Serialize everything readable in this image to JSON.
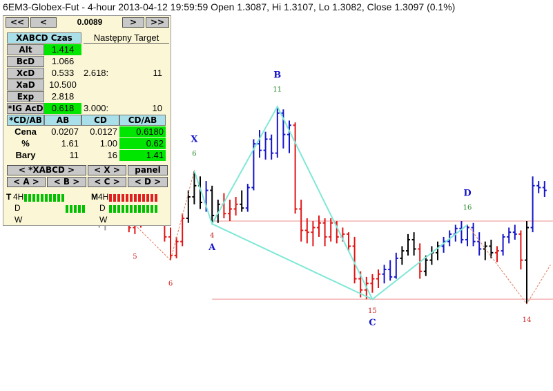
{
  "title": "6EM3-Globex-Fut - 4-hour 2013-04-12 19:59:59 Open 1.3087, Hi 1.3107, Lo 1.3082, Close 1.3097 (0.1%)",
  "colors": {
    "up": "#1515c8",
    "down": "#e01515",
    "neutral": "#000000",
    "gray": "#9a9a9a",
    "pattern_line": "#7fe8d6",
    "zigzag": "#e07a5a",
    "hline": "#f4b4b4",
    "label_blue": "#1515c8",
    "label_green": "#2a8a2a",
    "label_red": "#cc2222",
    "panel_bg": "#fbf7d6",
    "green_cell": "#00e600",
    "header_blue": "#a9dfe8"
  },
  "panel": {
    "nav": {
      "first": "<<",
      "prev": "<",
      "value": "0.0089",
      "next": ">",
      "last": ">>"
    },
    "header_left": "XABCD Czas",
    "header_right": "Następny Target",
    "ratios": [
      {
        "label": "Alt",
        "value": "1.414",
        "target": "",
        "count": ""
      },
      {
        "label": "BcD",
        "value": "1.066",
        "target": "",
        "count": ""
      },
      {
        "label": "XcD",
        "value": "0.533",
        "target": "2.618:",
        "count": "11"
      },
      {
        "label": "XaD",
        "value": "10.500",
        "target": "",
        "count": ""
      },
      {
        "label": "Exp",
        "value": "2.818",
        "target": "",
        "count": ""
      },
      {
        "label": "*IG AcD",
        "value": "0.618",
        "target": "3.000:",
        "count": "10"
      }
    ],
    "table": {
      "cols": [
        "*CD/AB",
        "AB",
        "CD",
        "CD/AB"
      ],
      "rows": [
        {
          "label": "Cena",
          "ab": "0.0207",
          "cd": "0.0127",
          "cdab": "0.6180"
        },
        {
          "label": "%",
          "ab": "1.61",
          "cd": "1.00",
          "cdab": "0.62"
        },
        {
          "label": "Bary",
          "ab": "11",
          "cd": "16",
          "cdab": "1.41"
        }
      ]
    },
    "buttons_row1": {
      "xabcd": "<    *XABCD    >",
      "x": "<  X  >",
      "panel": "panel"
    },
    "buttons_row2": {
      "a": "<  A  >",
      "b": "<  B  >",
      "c": "<  C  >",
      "d": "<  D  >"
    },
    "trend": {
      "t_label": "T",
      "m_label": "M",
      "tf_4h": "4H",
      "tf_d": "D",
      "tf_w": "W"
    }
  },
  "chart_data": {
    "type": "ohlc",
    "instrument": "6EM3-Globex-Fut",
    "timeframe": "4-hour",
    "ylim": [
      1.2785,
      1.3145
    ],
    "pattern_points": [
      {
        "name": "X",
        "bar": 24,
        "price": 1.3006,
        "bar_count": "6"
      },
      {
        "name": "A",
        "bar": 27,
        "price": 1.2949,
        "bar_count": "4"
      },
      {
        "name": "B",
        "bar": 38,
        "price": 1.3075,
        "bar_count": "11"
      },
      {
        "name": "C",
        "bar": 54,
        "price": 1.2868,
        "bar_count": "15"
      },
      {
        "name": "D",
        "bar": 70,
        "price": 1.2948,
        "bar_count": "16"
      }
    ],
    "zigzag_labels": [
      {
        "text": "5",
        "bar": 14,
        "price": 1.2931
      },
      {
        "text": "6",
        "bar": 20,
        "price": 1.2902
      },
      {
        "text": "14",
        "bar": 80,
        "price": 1.2863
      }
    ],
    "hlines": [
      1.2952,
      1.2868
    ],
    "bars": [
      {
        "o": 1.299,
        "h": 1.2995,
        "l": 1.297,
        "c": 1.2985,
        "col": "gray"
      },
      {
        "o": 1.2985,
        "h": 1.2992,
        "l": 1.2968,
        "c": 1.2975,
        "col": "gray"
      },
      {
        "o": 1.2975,
        "h": 1.2985,
        "l": 1.2962,
        "c": 1.298,
        "col": "gray"
      },
      {
        "o": 1.298,
        "h": 1.2988,
        "l": 1.2968,
        "c": 1.2972,
        "col": "gray"
      },
      {
        "o": 1.2972,
        "h": 1.298,
        "l": 1.296,
        "c": 1.2966,
        "col": "gray"
      },
      {
        "o": 1.2966,
        "h": 1.2975,
        "l": 1.2955,
        "c": 1.2962,
        "col": "gray"
      },
      {
        "o": 1.2962,
        "h": 1.297,
        "l": 1.295,
        "c": 1.2958,
        "col": "gray"
      },
      {
        "o": 1.2958,
        "h": 1.2966,
        "l": 1.2948,
        "c": 1.2955,
        "col": "gray"
      },
      {
        "o": 1.2955,
        "h": 1.2965,
        "l": 1.2945,
        "c": 1.295,
        "col": "gray"
      },
      {
        "o": 1.295,
        "h": 1.2962,
        "l": 1.2942,
        "c": 1.2958,
        "col": "gray"
      },
      {
        "o": 1.2958,
        "h": 1.297,
        "l": 1.295,
        "c": 1.2966,
        "col": "gray"
      },
      {
        "o": 1.2966,
        "h": 1.2975,
        "l": 1.2955,
        "c": 1.296,
        "col": "gray"
      },
      {
        "o": 1.296,
        "h": 1.297,
        "l": 1.295,
        "c": 1.2955,
        "col": "down"
      },
      {
        "o": 1.2955,
        "h": 1.2962,
        "l": 1.294,
        "c": 1.2945,
        "col": "down"
      },
      {
        "o": 1.2945,
        "h": 1.2955,
        "l": 1.2938,
        "c": 1.295,
        "col": "down"
      },
      {
        "o": 1.295,
        "h": 1.2966,
        "l": 1.2945,
        "c": 1.296,
        "col": "down"
      },
      {
        "o": 1.296,
        "h": 1.297,
        "l": 1.295,
        "c": 1.2962,
        "col": "down"
      },
      {
        "o": 1.2962,
        "h": 1.2975,
        "l": 1.2955,
        "c": 1.2968,
        "col": "down"
      },
      {
        "o": 1.2968,
        "h": 1.2975,
        "l": 1.295,
        "c": 1.2955,
        "col": "down"
      },
      {
        "o": 1.2955,
        "h": 1.296,
        "l": 1.293,
        "c": 1.2935,
        "col": "down"
      },
      {
        "o": 1.2935,
        "h": 1.2945,
        "l": 1.291,
        "c": 1.2915,
        "col": "down"
      },
      {
        "o": 1.2915,
        "h": 1.2935,
        "l": 1.2912,
        "c": 1.293,
        "col": "down"
      },
      {
        "o": 1.293,
        "h": 1.296,
        "l": 1.2925,
        "c": 1.2955,
        "col": "down"
      },
      {
        "o": 1.2955,
        "h": 1.2985,
        "l": 1.295,
        "c": 1.2978,
        "col": "neutral"
      },
      {
        "o": 1.2978,
        "h": 1.3006,
        "l": 1.297,
        "c": 1.299,
        "col": "neutral"
      },
      {
        "o": 1.299,
        "h": 1.3,
        "l": 1.2965,
        "c": 1.2972,
        "col": "neutral"
      },
      {
        "o": 1.2972,
        "h": 1.2995,
        "l": 1.2962,
        "c": 1.2985,
        "col": "up"
      },
      {
        "o": 1.2985,
        "h": 1.299,
        "l": 1.2949,
        "c": 1.2958,
        "col": "neutral"
      },
      {
        "o": 1.2958,
        "h": 1.2975,
        "l": 1.295,
        "c": 1.297,
        "col": "neutral"
      },
      {
        "o": 1.297,
        "h": 1.2982,
        "l": 1.2955,
        "c": 1.296,
        "col": "down"
      },
      {
        "o": 1.296,
        "h": 1.2975,
        "l": 1.2952,
        "c": 1.2965,
        "col": "down"
      },
      {
        "o": 1.2965,
        "h": 1.2978,
        "l": 1.2958,
        "c": 1.297,
        "col": "down"
      },
      {
        "o": 1.297,
        "h": 1.2985,
        "l": 1.2962,
        "c": 1.2966,
        "col": "neutral"
      },
      {
        "o": 1.2966,
        "h": 1.2992,
        "l": 1.2962,
        "c": 1.2988,
        "col": "up"
      },
      {
        "o": 1.2988,
        "h": 1.304,
        "l": 1.2985,
        "c": 1.3035,
        "col": "up"
      },
      {
        "o": 1.3035,
        "h": 1.305,
        "l": 1.302,
        "c": 1.3028,
        "col": "up"
      },
      {
        "o": 1.3028,
        "h": 1.3048,
        "l": 1.3018,
        "c": 1.304,
        "col": "up"
      },
      {
        "o": 1.304,
        "h": 1.3045,
        "l": 1.3018,
        "c": 1.3025,
        "col": "up"
      },
      {
        "o": 1.3025,
        "h": 1.3075,
        "l": 1.302,
        "c": 1.3068,
        "col": "up"
      },
      {
        "o": 1.3068,
        "h": 1.3072,
        "l": 1.303,
        "c": 1.3045,
        "col": "up"
      },
      {
        "o": 1.3045,
        "h": 1.306,
        "l": 1.3025,
        "c": 1.3055,
        "col": "up"
      },
      {
        "o": 1.3055,
        "h": 1.3058,
        "l": 1.296,
        "c": 1.2965,
        "col": "down"
      },
      {
        "o": 1.2965,
        "h": 1.2975,
        "l": 1.293,
        "c": 1.2942,
        "col": "down"
      },
      {
        "o": 1.2942,
        "h": 1.2955,
        "l": 1.2928,
        "c": 1.294,
        "col": "down"
      },
      {
        "o": 1.294,
        "h": 1.2952,
        "l": 1.2925,
        "c": 1.2945,
        "col": "down"
      },
      {
        "o": 1.2945,
        "h": 1.2958,
        "l": 1.2935,
        "c": 1.295,
        "col": "down"
      },
      {
        "o": 1.295,
        "h": 1.2955,
        "l": 1.2925,
        "c": 1.2935,
        "col": "down"
      },
      {
        "o": 1.2935,
        "h": 1.2955,
        "l": 1.293,
        "c": 1.295,
        "col": "down"
      },
      {
        "o": 1.295,
        "h": 1.2952,
        "l": 1.2928,
        "c": 1.2935,
        "col": "down"
      },
      {
        "o": 1.2935,
        "h": 1.2945,
        "l": 1.293,
        "c": 1.2938,
        "col": "down"
      },
      {
        "o": 1.2938,
        "h": 1.294,
        "l": 1.292,
        "c": 1.2925,
        "col": "down"
      },
      {
        "o": 1.2925,
        "h": 1.2935,
        "l": 1.2885,
        "c": 1.289,
        "col": "down"
      },
      {
        "o": 1.289,
        "h": 1.2898,
        "l": 1.287,
        "c": 1.2878,
        "col": "down"
      },
      {
        "o": 1.2878,
        "h": 1.2892,
        "l": 1.2868,
        "c": 1.2885,
        "col": "down"
      },
      {
        "o": 1.2885,
        "h": 1.2895,
        "l": 1.2875,
        "c": 1.289,
        "col": "down"
      },
      {
        "o": 1.289,
        "h": 1.29,
        "l": 1.288,
        "c": 1.2895,
        "col": "down"
      },
      {
        "o": 1.2895,
        "h": 1.2905,
        "l": 1.2885,
        "c": 1.29,
        "col": "up"
      },
      {
        "o": 1.29,
        "h": 1.291,
        "l": 1.2888,
        "c": 1.2892,
        "col": "up"
      },
      {
        "o": 1.2892,
        "h": 1.2918,
        "l": 1.289,
        "c": 1.2912,
        "col": "up"
      },
      {
        "o": 1.2912,
        "h": 1.2925,
        "l": 1.2905,
        "c": 1.292,
        "col": "neutral"
      },
      {
        "o": 1.292,
        "h": 1.2938,
        "l": 1.2915,
        "c": 1.2932,
        "col": "neutral"
      },
      {
        "o": 1.2932,
        "h": 1.294,
        "l": 1.2915,
        "c": 1.2922,
        "col": "neutral"
      },
      {
        "o": 1.2922,
        "h": 1.2928,
        "l": 1.289,
        "c": 1.2898,
        "col": "down"
      },
      {
        "o": 1.2898,
        "h": 1.2915,
        "l": 1.2893,
        "c": 1.291,
        "col": "neutral"
      },
      {
        "o": 1.291,
        "h": 1.2925,
        "l": 1.2905,
        "c": 1.2918,
        "col": "neutral"
      },
      {
        "o": 1.2918,
        "h": 1.293,
        "l": 1.291,
        "c": 1.2925,
        "col": "neutral"
      },
      {
        "o": 1.2925,
        "h": 1.2935,
        "l": 1.2918,
        "c": 1.293,
        "col": "up"
      },
      {
        "o": 1.293,
        "h": 1.2942,
        "l": 1.2925,
        "c": 1.2938,
        "col": "up"
      },
      {
        "o": 1.2938,
        "h": 1.2948,
        "l": 1.293,
        "c": 1.2944,
        "col": "up"
      },
      {
        "o": 1.2944,
        "h": 1.2952,
        "l": 1.2928,
        "c": 1.2932,
        "col": "up"
      },
      {
        "o": 1.2932,
        "h": 1.2948,
        "l": 1.2925,
        "c": 1.2945,
        "col": "up"
      },
      {
        "o": 1.2945,
        "h": 1.295,
        "l": 1.2925,
        "c": 1.293,
        "col": "up"
      },
      {
        "o": 1.293,
        "h": 1.294,
        "l": 1.2915,
        "c": 1.2922,
        "col": "up"
      },
      {
        "o": 1.2922,
        "h": 1.293,
        "l": 1.291,
        "c": 1.2925,
        "col": "neutral"
      },
      {
        "o": 1.2925,
        "h": 1.2932,
        "l": 1.2912,
        "c": 1.2918,
        "col": "neutral"
      },
      {
        "o": 1.2918,
        "h": 1.2925,
        "l": 1.2908,
        "c": 1.292,
        "col": "down"
      },
      {
        "o": 1.292,
        "h": 1.2938,
        "l": 1.2915,
        "c": 1.2935,
        "col": "up"
      },
      {
        "o": 1.2935,
        "h": 1.2945,
        "l": 1.2928,
        "c": 1.294,
        "col": "up"
      },
      {
        "o": 1.294,
        "h": 1.2948,
        "l": 1.2932,
        "c": 1.2938,
        "col": "up"
      },
      {
        "o": 1.2938,
        "h": 1.2942,
        "l": 1.29,
        "c": 1.291,
        "col": "down"
      },
      {
        "o": 1.291,
        "h": 1.2952,
        "l": 1.2863,
        "c": 1.2945,
        "col": "neutral"
      },
      {
        "o": 1.2945,
        "h": 1.3,
        "l": 1.294,
        "c": 1.299,
        "col": "up"
      },
      {
        "o": 1.299,
        "h": 1.2995,
        "l": 1.2982,
        "c": 1.2988,
        "col": "up"
      },
      {
        "o": 1.2988,
        "h": 1.2995,
        "l": 1.2978,
        "c": 1.2985,
        "col": "up"
      }
    ]
  }
}
